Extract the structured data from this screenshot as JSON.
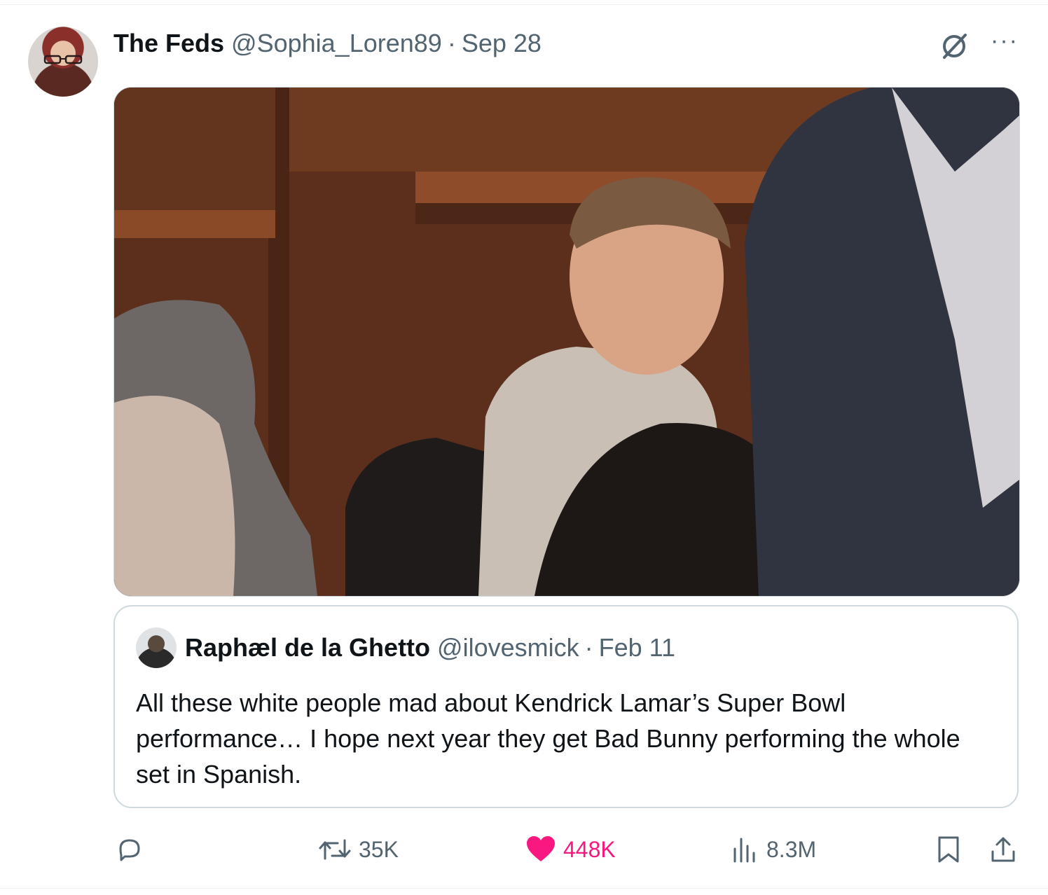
{
  "tweet": {
    "display_name": "The Feds",
    "handle": "@Sophia_Loren89",
    "separator": "·",
    "date": "Sep 28"
  },
  "quoted_tweet": {
    "display_name": "Raphæl de la Ghetto",
    "handle": "@ilovesmick",
    "separator": "·",
    "date": "Feb 11",
    "text": "All these white people mad about Kendrick Lamar’s Super Bowl performance… I hope next year they get Bad Bunny performing the whole set in Spanish."
  },
  "actions": {
    "reply": {
      "icon": "reply-icon",
      "count": ""
    },
    "retweet": {
      "icon": "retweet-icon",
      "count": "35K"
    },
    "like": {
      "icon": "heart-icon",
      "count": "448K",
      "color": "#f91880",
      "liked": true
    },
    "views": {
      "icon": "views-icon",
      "count": "8.3M"
    },
    "bookmark": {
      "icon": "bookmark-icon"
    },
    "share": {
      "icon": "share-icon"
    }
  },
  "header_icons": {
    "grok": "grok-icon",
    "more": "more-icon",
    "more_glyph": "···"
  },
  "colors": {
    "text": "#0f1419",
    "secondary": "#536471",
    "border": "#cfd9de",
    "like": "#f91880"
  }
}
